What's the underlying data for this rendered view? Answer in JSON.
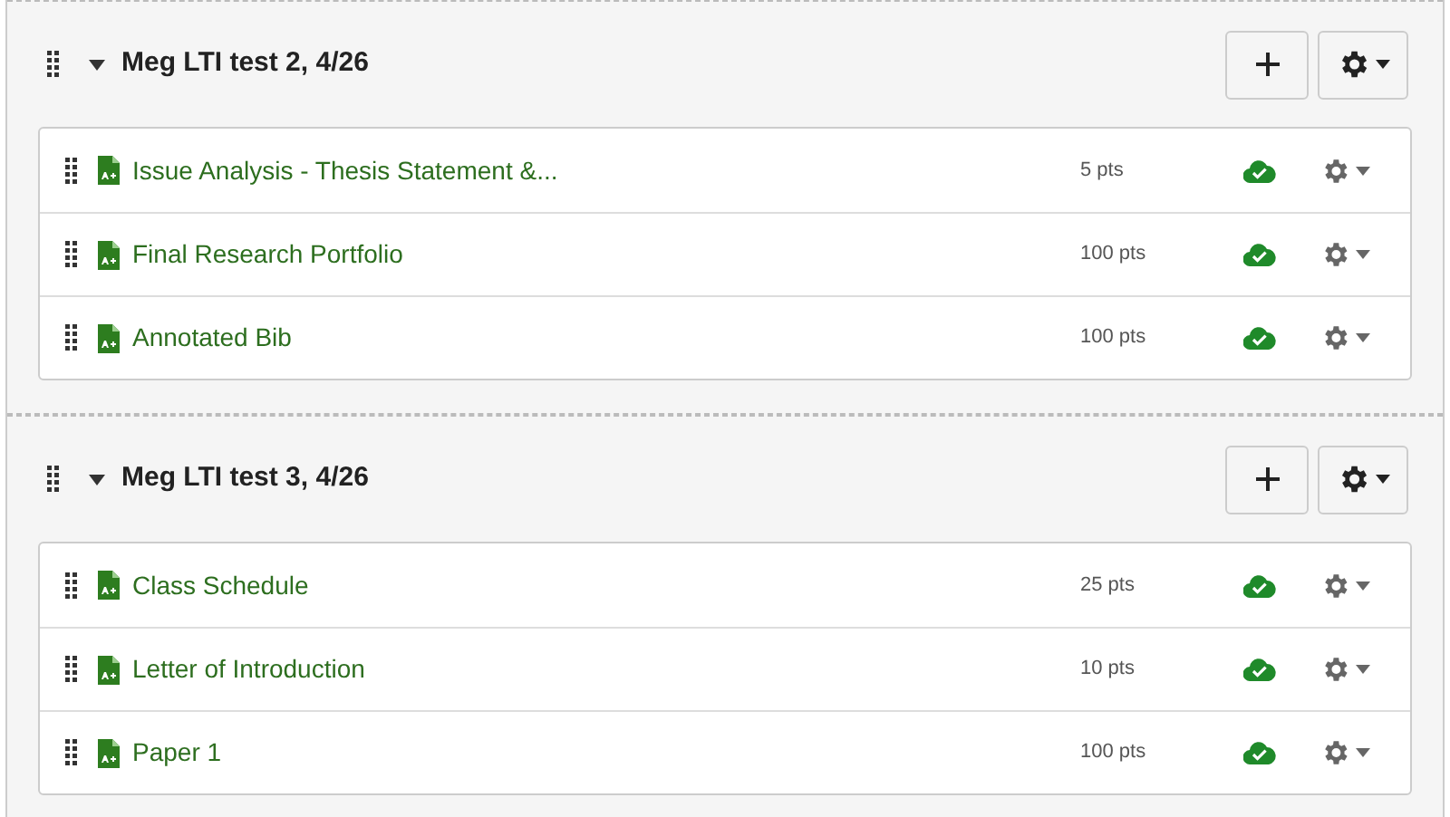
{
  "modules": [
    {
      "title": "Meg LTI test 2, 4/26",
      "expanded": true,
      "items": [
        {
          "title": "Issue Analysis - Thesis Statement &...",
          "points": "5 pts",
          "published": true
        },
        {
          "title": "Final Research Portfolio",
          "points": "100 pts",
          "published": true
        },
        {
          "title": "Annotated Bib",
          "points": "100 pts",
          "published": true
        }
      ]
    },
    {
      "title": "Meg LTI test 3, 4/26",
      "expanded": true,
      "items": [
        {
          "title": "Class Schedule",
          "points": "25 pts",
          "published": true
        },
        {
          "title": "Letter of Introduction",
          "points": "10 pts",
          "published": true
        },
        {
          "title": "Paper 1",
          "points": "100 pts",
          "published": true
        }
      ]
    }
  ]
}
